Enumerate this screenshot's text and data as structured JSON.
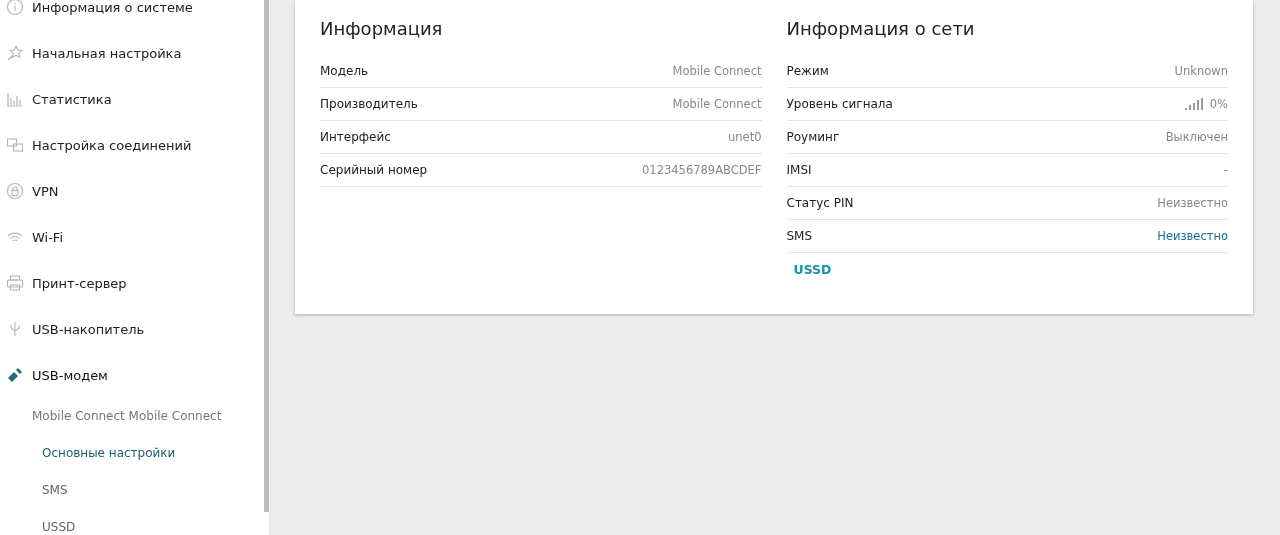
{
  "sidebar": {
    "items": [
      {
        "label": "Информация о системе",
        "selected": false
      },
      {
        "label": "Начальная настройка",
        "selected": false
      },
      {
        "label": "Статистика",
        "selected": false
      },
      {
        "label": "Настройка соединений",
        "selected": false
      },
      {
        "label": "VPN",
        "selected": false
      },
      {
        "label": "Wi-Fi",
        "selected": false
      },
      {
        "label": "Принт-сервер",
        "selected": false
      },
      {
        "label": "USB-накопитель",
        "selected": false
      },
      {
        "label": "USB-модем",
        "selected": true,
        "children": [
          {
            "label": "Mobile Connect Mobile Connect",
            "children": [
              {
                "label": "Основные настройки",
                "selected": true
              },
              {
                "label": "SMS",
                "selected": false
              },
              {
                "label": "USSD",
                "selected": false
              }
            ]
          }
        ]
      }
    ]
  },
  "panels": [
    {
      "title": "Информация",
      "rows": [
        {
          "kind": "text",
          "label": "Модель",
          "value": "Mobile Connect"
        },
        {
          "kind": "text",
          "label": "Производитель",
          "value": "Mobile Connect"
        },
        {
          "kind": "text",
          "label": "Интерфейс",
          "value": "unet0"
        },
        {
          "kind": "text",
          "label": "Серийный номер",
          "value": "0123456789ABCDEF"
        }
      ]
    },
    {
      "title": "Информация о сети",
      "rows": [
        {
          "kind": "text",
          "label": "Режим",
          "value": "Unknown"
        },
        {
          "kind": "signal",
          "label": "Уровень сигнала",
          "value": "0%"
        },
        {
          "kind": "text",
          "label": "Роуминг",
          "value": "Выключен"
        },
        {
          "kind": "text",
          "label": "IMSI",
          "value": "-"
        },
        {
          "kind": "text",
          "label": "Статус PIN",
          "value": "Неизвестно"
        },
        {
          "kind": "link",
          "label": "SMS",
          "value": "Неизвестно"
        }
      ],
      "link": "USSD"
    }
  ]
}
